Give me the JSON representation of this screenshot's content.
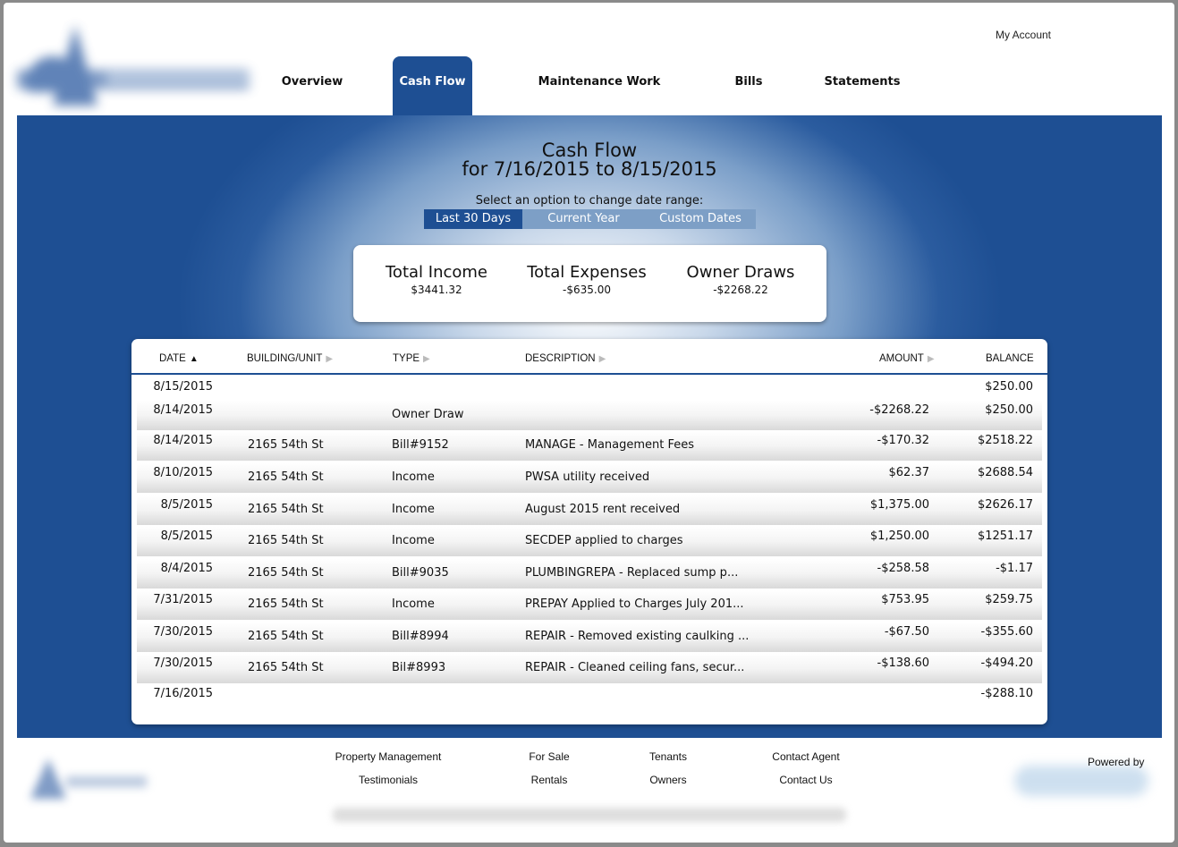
{
  "header": {
    "my_account": "My Account",
    "nav": [
      {
        "label": "Overview"
      },
      {
        "label": "Cash Flow",
        "active": true
      },
      {
        "label": "Maintenance Work Orders"
      },
      {
        "label": "Bills"
      },
      {
        "label": "Statements"
      }
    ]
  },
  "page": {
    "title_line1": "Cash Flow",
    "title_line2": "for 7/16/2015 to 8/15/2015",
    "range_prompt": "Select an option to change date range:",
    "range_options": [
      {
        "label": "Last 30 Days",
        "active": true
      },
      {
        "label": "Current Year"
      },
      {
        "label": "Custom Dates"
      }
    ]
  },
  "summary": {
    "income_label": "Total Income",
    "income_value": "$3441.32",
    "expenses_label": "Total Expenses",
    "expenses_value": "-$635.00",
    "draws_label": "Owner Draws",
    "draws_value": "-$2268.22"
  },
  "table": {
    "headers": {
      "date": "DATE",
      "building": "BUILDING/UNIT",
      "type": "TYPE",
      "description": "DESCRIPTION",
      "amount": "AMOUNT",
      "balance": "BALANCE"
    },
    "rows": [
      {
        "date": "8/15/2015",
        "building": "",
        "type": "",
        "description": "",
        "amount": "",
        "balance": "$250.00"
      },
      {
        "date": "8/14/2015",
        "building": "",
        "type": "Owner Draw",
        "description": "",
        "amount": "-$2268.22",
        "balance": "$250.00"
      },
      {
        "date": "8/14/2015",
        "building": "2165 54th St",
        "type": "Bill#9152",
        "description": "MANAGE - Management Fees",
        "amount": "-$170.32",
        "balance": "$2518.22"
      },
      {
        "date": "8/10/2015",
        "building": "2165 54th St",
        "type": "Income",
        "description": "PWSA utility received",
        "amount": "$62.37",
        "balance": "$2688.54"
      },
      {
        "date": "8/5/2015",
        "building": "2165 54th St",
        "type": "Income",
        "description": "August 2015 rent received",
        "amount": "$1,375.00",
        "balance": "$2626.17"
      },
      {
        "date": "8/5/2015",
        "building": "2165 54th St",
        "type": "Income",
        "description": "SECDEP applied to charges",
        "amount": "$1,250.00",
        "balance": "$1251.17"
      },
      {
        "date": "8/4/2015",
        "building": "2165 54th St",
        "type": "Bill#9035",
        "description": "PLUMBINGREPA - Replaced sump p...",
        "amount": "-$258.58",
        "balance": "-$1.17"
      },
      {
        "date": "7/31/2015",
        "building": "2165 54th St",
        "type": "Income",
        "description": "PREPAY Applied to Charges July 201...",
        "amount": "$753.95",
        "balance": "$259.75"
      },
      {
        "date": "7/30/2015",
        "building": "2165 54th St",
        "type": "Bill#8994",
        "description": "REPAIR - Removed existing caulking ...",
        "amount": "-$67.50",
        "balance": "-$355.60"
      },
      {
        "date": "7/30/2015",
        "building": "2165 54th St",
        "type": "Bil#8993",
        "description": "REPAIR - Cleaned ceiling fans, secur...",
        "amount": "-$138.60",
        "balance": "-$494.20"
      },
      {
        "date": "7/16/2015",
        "building": "",
        "type": "",
        "description": "",
        "amount": "",
        "balance": "-$288.10"
      }
    ]
  },
  "footer": {
    "links": [
      {
        "label": "Property Management"
      },
      {
        "label": "Testimonials"
      },
      {
        "label": "For Sale"
      },
      {
        "label": "Rentals"
      },
      {
        "label": "Tenants"
      },
      {
        "label": "Owners"
      },
      {
        "label": "Contact Agent"
      },
      {
        "label": "Contact Us"
      }
    ],
    "powered_by": "Powered by"
  },
  "colors": {
    "brand_blue": "#1e4f93",
    "range_inactive": "#7d9fc6"
  }
}
